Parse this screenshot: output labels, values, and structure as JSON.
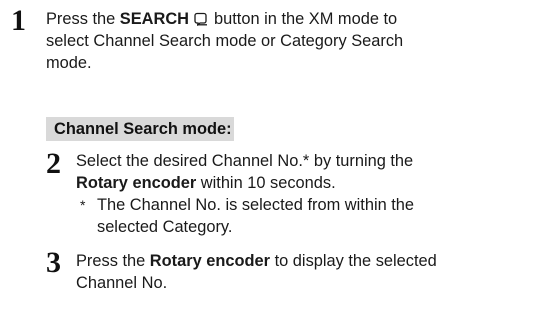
{
  "step1": {
    "number": "1",
    "before": "Press the ",
    "button_name": "SEARCH",
    "after_icon": "button in the XM mode to",
    "line2": "select Channel Search mode or Category Search",
    "line3": "mode."
  },
  "mode_header": "Channel Search mode:",
  "step2": {
    "number": "2",
    "line1_before": "Select the desired Channel No.",
    "line1_asterisk": "*",
    "line1_after": " by turning the",
    "line2_bold": "Rotary encoder",
    "line2_after": " within 10 seconds."
  },
  "note": {
    "asterisk": "*",
    "line1": "The Channel No. is selected from within the",
    "line2": "selected Category."
  },
  "step3": {
    "number": "3",
    "before": "Press the ",
    "bold": "Rotary encoder",
    "after": " to display the selected",
    "line2": "Channel No."
  },
  "icons": {
    "search": "search-icon"
  }
}
